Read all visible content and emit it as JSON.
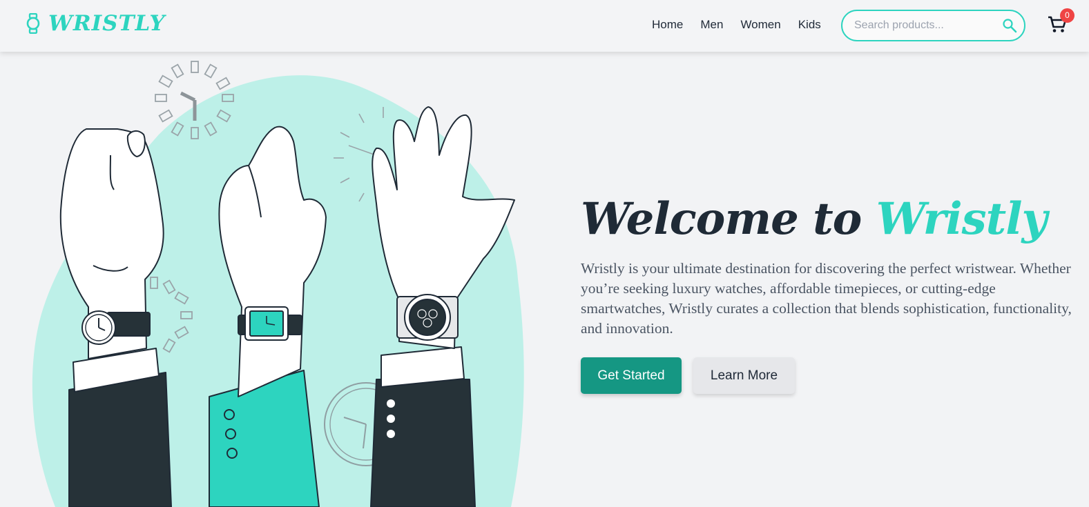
{
  "brand": {
    "name": "WRISTLY",
    "icon": "watch-icon",
    "accent": "#2dd4bf"
  },
  "nav": {
    "items": [
      {
        "label": "Home"
      },
      {
        "label": "Men"
      },
      {
        "label": "Women"
      },
      {
        "label": "Kids"
      }
    ]
  },
  "search": {
    "placeholder": "Search products...",
    "value": "",
    "icon": "search-icon"
  },
  "cart": {
    "icon": "shopping-cart-icon",
    "count": "0",
    "badge_color": "#ef4444"
  },
  "hero": {
    "title_prefix": "Welcome to",
    "title_brand": "Wristly",
    "description": "Wristly is your ultimate destination for discovering the perfect wristwear. Whether you’re seeking luxury watches, affordable timepieces, or cutting-edge smartwatches, Wristly curates a collection that blends sophistication, functionality, and innovation.",
    "primary_button": "Get Started",
    "secondary_button": "Learn More",
    "primary_color": "#159783",
    "illustration": "three-raised-hands-wearing-watches"
  }
}
